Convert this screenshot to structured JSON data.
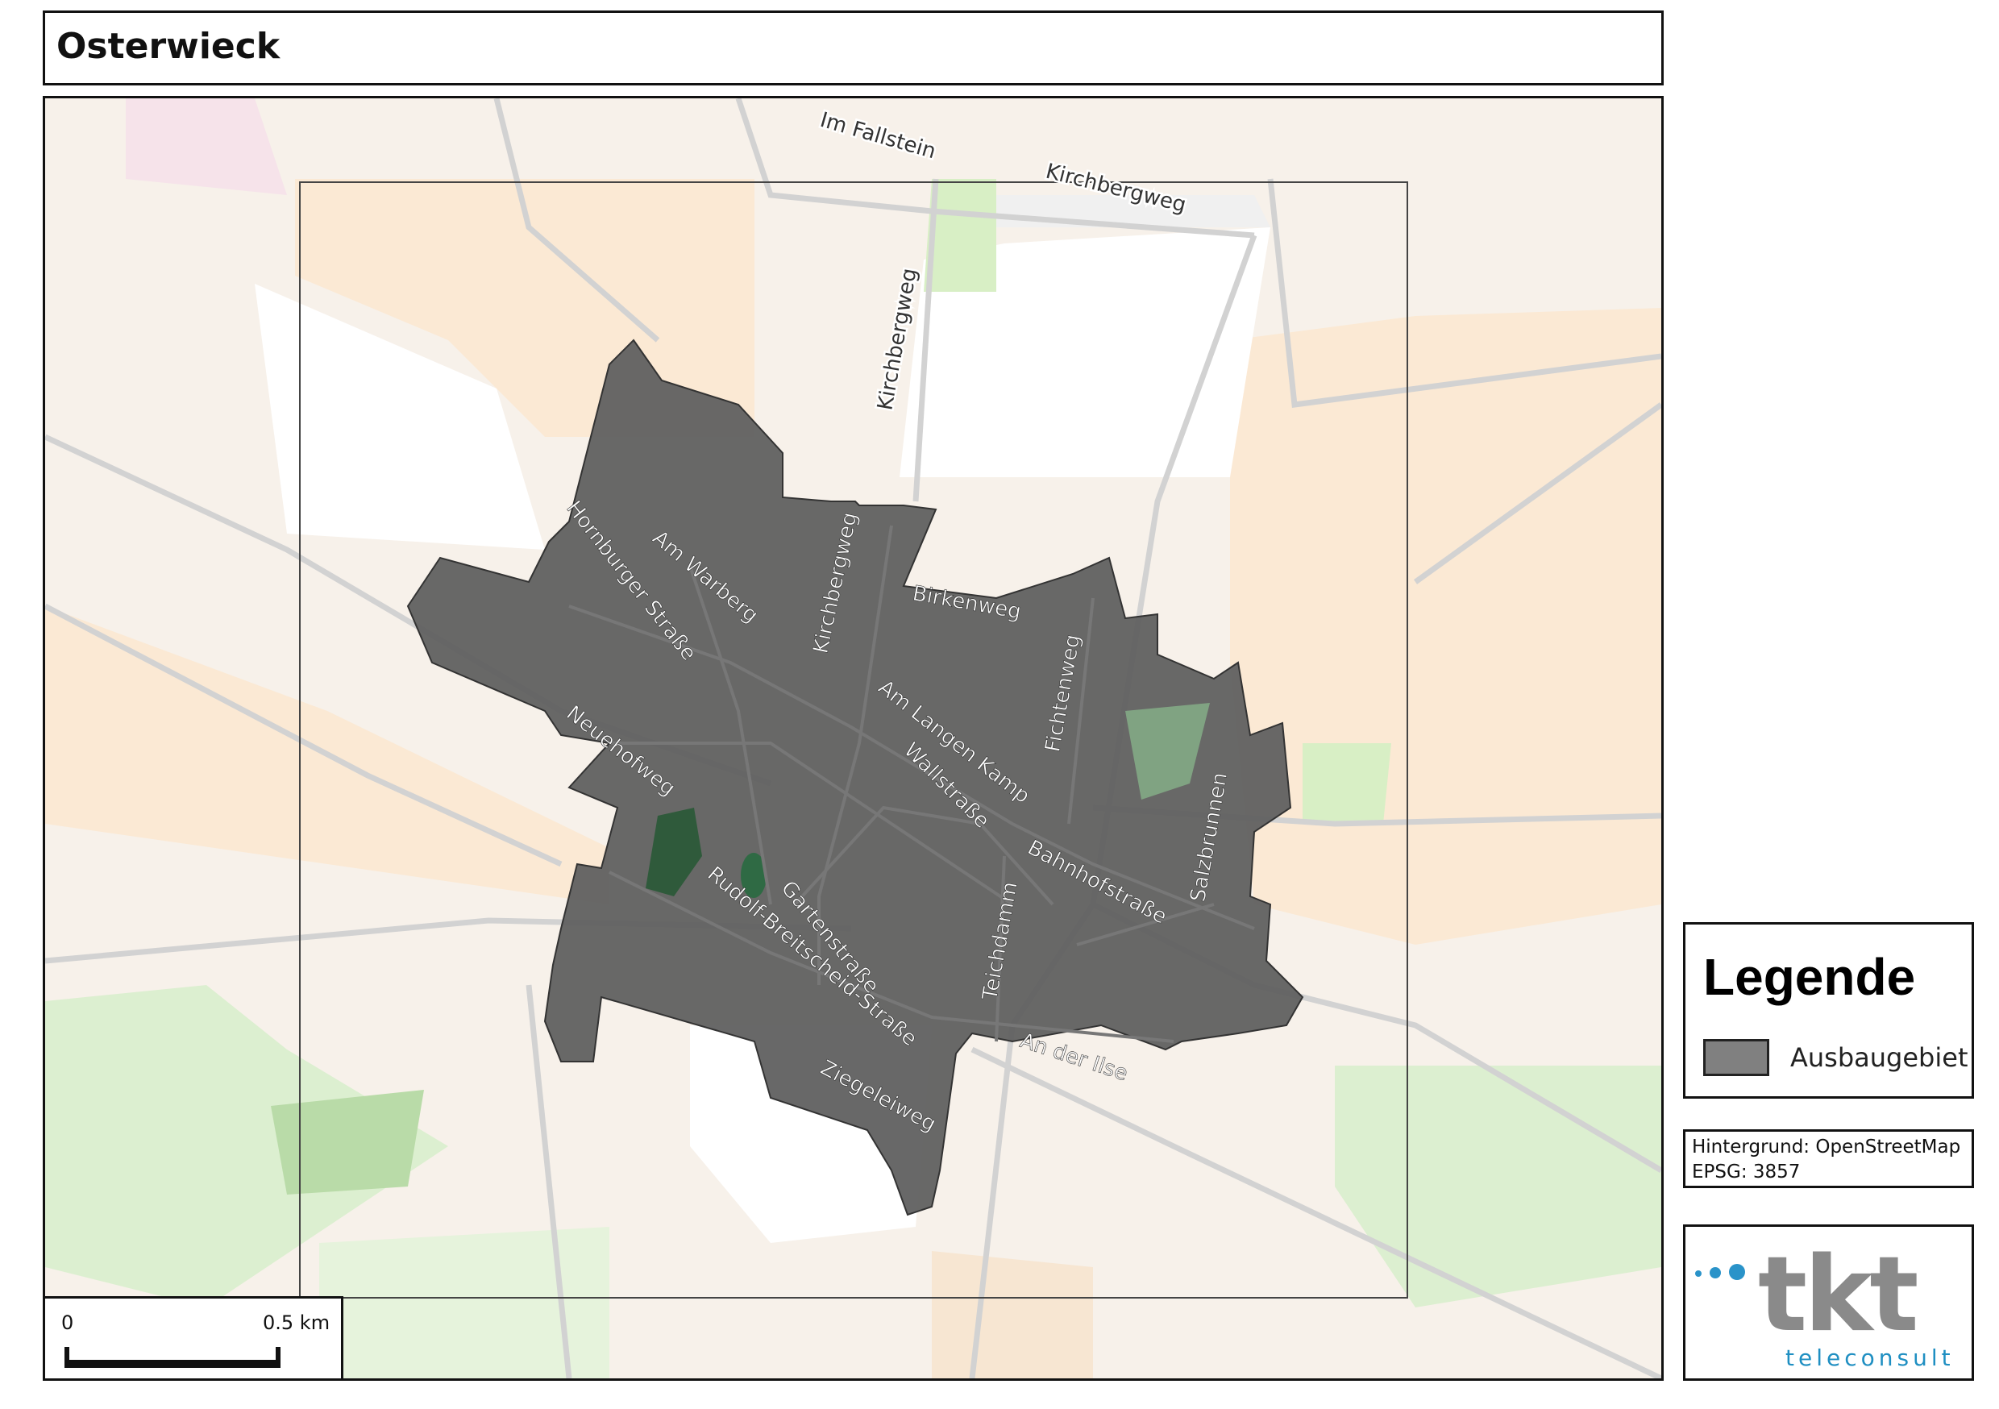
{
  "title": "Osterwieck",
  "legend": {
    "title": "Legende",
    "item_label": "Ausbaugebiet",
    "item_color": "#808080"
  },
  "source": {
    "line1": "Hintergrund: OpenStreetMap",
    "line2": "EPSG: 3857"
  },
  "scale": {
    "start": "0",
    "end": "0.5 km"
  },
  "logo": {
    "mark": "tkt",
    "subtitle": "teleconsult"
  },
  "colors": {
    "area_fill": "#606060",
    "farmland": "#fbe9d4",
    "meadow": "#d9efc7",
    "forest": "#b9dba8",
    "industrial": "#ebdbe8",
    "road": "#cfcfcf"
  },
  "streets": {
    "im_fallstein": "Im Fallstein",
    "kirchbergweg_top": "Kirchbergweg",
    "kirchbergweg_vertical": "Kirchbergweg",
    "kirchbergweg_center": "Kirchbergweg",
    "hornburger": "Hornburger Straße",
    "am_warberg": "Am Warberg",
    "birkenweg": "Birkenweg",
    "fichtenweg": "Fichtenweg",
    "am_langen_kamp": "Am Langen Kamp",
    "neuehofweg": "Neuehofweg",
    "wallstrasse": "Wallstraße",
    "salzbrunnen": "Salzbrunnen",
    "bahnhofstrasse": "Bahnhofstraße",
    "gartenstrasse": "Gartenstraße",
    "rudolf": "Rudolf-Breitscheid-Straße",
    "teichdamm": "Teichdamm",
    "an_der_ilse": "An der Ilse",
    "ziegeleiweg": "Ziegeleiweg"
  }
}
